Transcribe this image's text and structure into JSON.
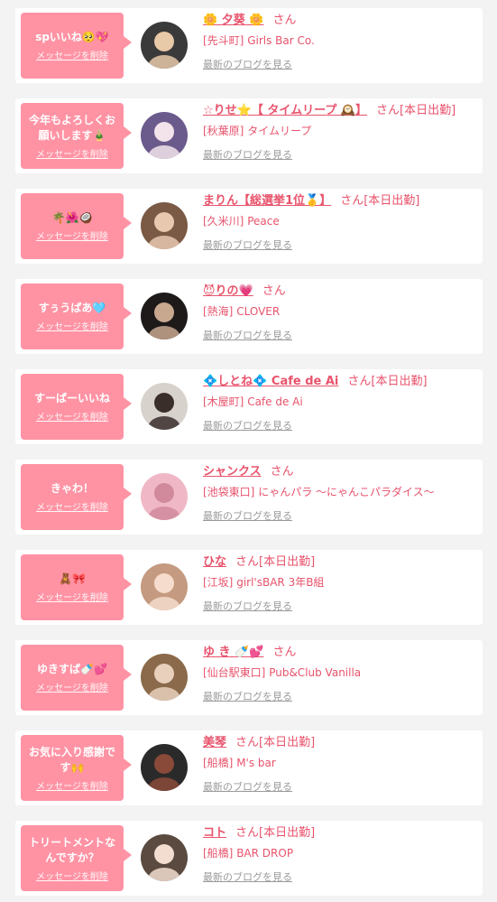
{
  "colors": {
    "bubble": "#ff93a4",
    "accent": "#e8536c",
    "link_gray": "#9a9a9a",
    "background": "#f3f3f3"
  },
  "delete_label": "メッセージを削除",
  "blog_label": "最新のブログを見る",
  "cards": [
    {
      "message": "spいいね🥺💖",
      "name": "🌼 夕葵 🌼",
      "suffix": "さん",
      "area": "[先斗町]",
      "shop": "Girls Bar Co."
    },
    {
      "message": "今年もよろしくお願いします🎍",
      "name": "☆りせ⭐️【 タイムリープ 🕰️】",
      "suffix": "さん[本日出勤]",
      "area": "[秋葉原]",
      "shop": "タイムリープ"
    },
    {
      "message": "🌴🌺🥥",
      "name": "まりん【総選挙1位🥇】",
      "suffix": "さん[本日出勤]",
      "area": "[久米川]",
      "shop": "Peace"
    },
    {
      "message": "すぅうぱあ🩵",
      "name": "😈りの💗",
      "suffix": "さん",
      "area": "[熱海]",
      "shop": "CLOVER"
    },
    {
      "message": "すーぱーいいね",
      "name": "💠しとね💠 Cafe de Ai",
      "suffix": "さん[本日出勤]",
      "area": "[木屋町]",
      "shop": "Cafe de Ai"
    },
    {
      "message": "きゃわ！",
      "name": "シャンクス",
      "suffix": "さん",
      "area": "[池袋東口]",
      "shop": "にゃんパラ 〜にゃんこパラダイス〜"
    },
    {
      "message": "🧸🎀",
      "name": "ひな",
      "suffix": "さん[本日出勤]",
      "area": "[江坂]",
      "shop": "girl'sBAR 3年B組"
    },
    {
      "message": "ゆきすぱ🍼💕",
      "name": "ゆ き 🍼💕",
      "suffix": "さん",
      "area": "[仙台駅東口]",
      "shop": "Pub&Club Vanilla"
    },
    {
      "message": "お気に入り感謝です🙌",
      "name": "美琴",
      "suffix": "さん[本日出勤]",
      "area": "[船橋]",
      "shop": "M's bar"
    },
    {
      "message": "トリートメントなんですか？",
      "name": "コト",
      "suffix": "さん[本日出勤]",
      "area": "[船橋]",
      "shop": "BAR DROP"
    }
  ],
  "avatars": [
    {
      "c1": "#3a3a3a",
      "c2": "#e8c9a8"
    },
    {
      "c1": "#6b5a8c",
      "c2": "#f2e4ea"
    },
    {
      "c1": "#7a5a44",
      "c2": "#e9c8b0"
    },
    {
      "c1": "#1e1a1a",
      "c2": "#c9a890"
    },
    {
      "c1": "#d8d2cc",
      "c2": "#3a2e2a"
    },
    {
      "c1": "#f0b8c6",
      "c2": "#d08a9c"
    },
    {
      "c1": "#c49a80",
      "c2": "#f6dccc"
    },
    {
      "c1": "#8a6a4a",
      "c2": "#e8d0bc"
    },
    {
      "c1": "#2a2a2a",
      "c2": "#8a4a3a"
    },
    {
      "c1": "#5a4a40",
      "c2": "#f2ddd0"
    }
  ]
}
